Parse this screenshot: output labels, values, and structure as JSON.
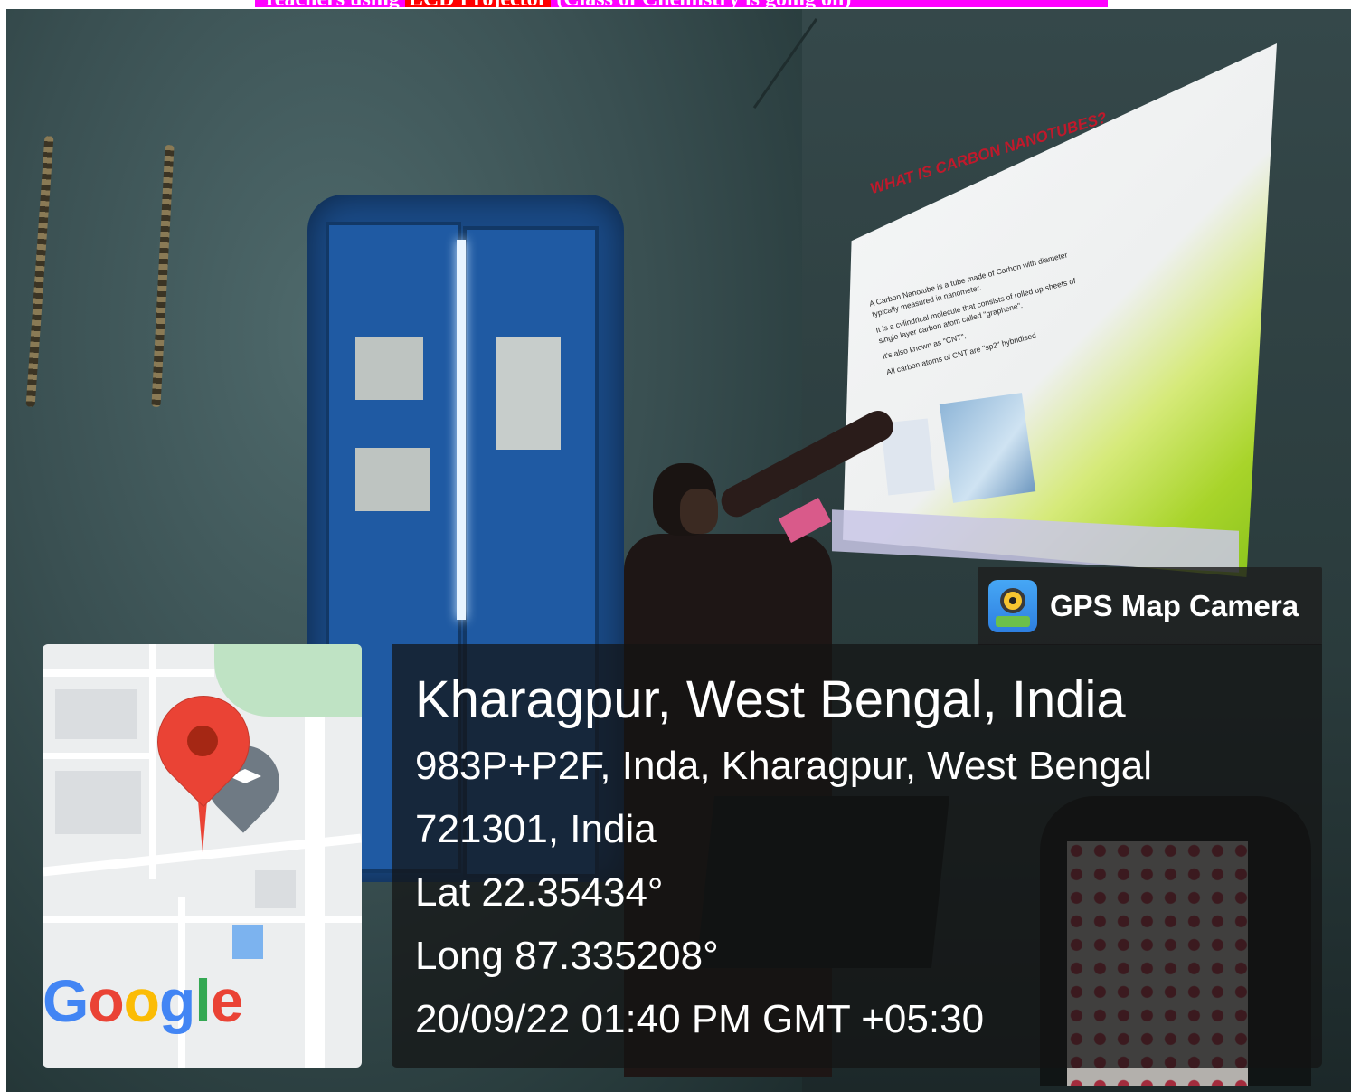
{
  "top_caption": {
    "before": "Teachers using",
    "highlight": "LCD Projector",
    "after": "(Class of Chemistry is going on)"
  },
  "slide": {
    "title": "WHAT IS CARBON NANOTUBES?",
    "bullets": [
      "A Carbon Nanotube is a tube made of Carbon with diameter typically measured in nanometer.",
      "It is a cylindrical molecule that consists of rolled up sheets of single layer carbon atom called \"graphene\".",
      "It's also known as \"CNT\".",
      "All carbon atoms of CNT are \"sp2\" hybridised"
    ]
  },
  "gps_badge": {
    "label": "GPS Map Camera",
    "icon": "gps-map-camera-icon"
  },
  "info": {
    "location_title": "Kharagpur, West Bengal, India",
    "address_line1": "983P+P2F, Inda, Kharagpur, West Bengal",
    "address_line2": "721301, India",
    "latitude": "Lat 22.35434°",
    "longitude": "Long 87.335208°",
    "datetime": "20/09/22 01:40 PM GMT +05:30"
  },
  "map": {
    "brand": "Google",
    "brand_letters": [
      {
        "char": "G",
        "color": "#4285f4"
      },
      {
        "char": "o",
        "color": "#ea4335"
      },
      {
        "char": "o",
        "color": "#fbbc05"
      },
      {
        "char": "g",
        "color": "#4285f4"
      },
      {
        "char": "l",
        "color": "#34a853"
      },
      {
        "char": "e",
        "color": "#ea4335"
      }
    ],
    "pin_icon": "map-pin-icon",
    "school_icon": "school-pin-icon"
  },
  "colors": {
    "caption_background": "#ff00ff",
    "caption_highlight": "#ff0000",
    "overlay": "#141414",
    "pin": "#ea4335"
  }
}
